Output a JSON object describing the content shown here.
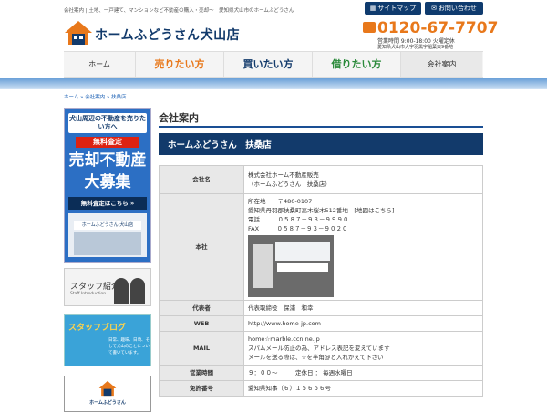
{
  "header": {
    "tagline": "会社案内 | 土地、一戸建て、マンションなど不動産の購入・売却～　愛知県犬山市のホームふどうさん",
    "sitemap_label": "サイトマップ",
    "contact_label": "お問い合わせ",
    "logo_text": "ホームふどうさん犬山店",
    "phone": "0120-67-7707",
    "hours": "営業時間 9:00-18:00 火曜定休",
    "address": "愛知県犬山市大字羽黒字稲葉東9番地"
  },
  "nav": {
    "items": [
      "ホーム",
      "売りたい方",
      "買いたい方",
      "借りたい方",
      "会社案内"
    ]
  },
  "breadcrumb": "ホーム » 会社案内 » 扶桑店",
  "sidebar": {
    "banner1": {
      "line1": "犬山周辺の不動産を売りたい方へ",
      "line2": "無料査定",
      "line3a": "売却不動産",
      "line3b": "大募集",
      "line4": "無料査定はこちら »",
      "sign": "ホームふどうさん 犬山店"
    },
    "banner2": {
      "title": "スタッフ紹介",
      "sub": "Staff Introduction"
    },
    "banner3": {
      "title": "スタッフブログ",
      "sub": "日常、趣味、日頃、そして犬山のことについて書いています。"
    },
    "banner4": {
      "label": "ホームふどうさん"
    }
  },
  "main": {
    "title": "会社案内",
    "subhead": "ホームふどうさん　扶桑店",
    "rows": [
      {
        "label": "会社名",
        "lines": [
          "株式会社ホーム不動産販売",
          "（ホームふどうさん　扶桑店）"
        ]
      },
      {
        "label": "本社",
        "lines": [
          "所在地　　〒480-0107",
          "愛知県丹羽郡扶桑町高木桜木512番地　[地図はこちら]",
          "電話　　　０５８７－９３－９９９０",
          "FAX　　　０５８７－９３－９０２０"
        ]
      },
      {
        "label": "代表者",
        "lines": [
          "代表取締役　保浦　和幸"
        ]
      },
      {
        "label": "WEB",
        "lines": [
          "http://www.home-jp.com"
        ]
      },
      {
        "label": "MAIL",
        "lines": [
          "home☆marble.ccn.ne.jp",
          "スパムメール防止の為、アドレス表記を変えています",
          "メールを送る際は、☆を半角@と入れかえて下さい"
        ]
      },
      {
        "label": "営業時間",
        "lines": [
          "９：００～　　　定休日 ： 毎週水曜日"
        ]
      },
      {
        "label": "免許番号",
        "lines": [
          "愛知県知事（６）１５６５６号"
        ]
      }
    ]
  },
  "colors": {
    "navy": "#123a6b",
    "orange": "#e8781b",
    "accent_blue": "#1a4f94"
  }
}
